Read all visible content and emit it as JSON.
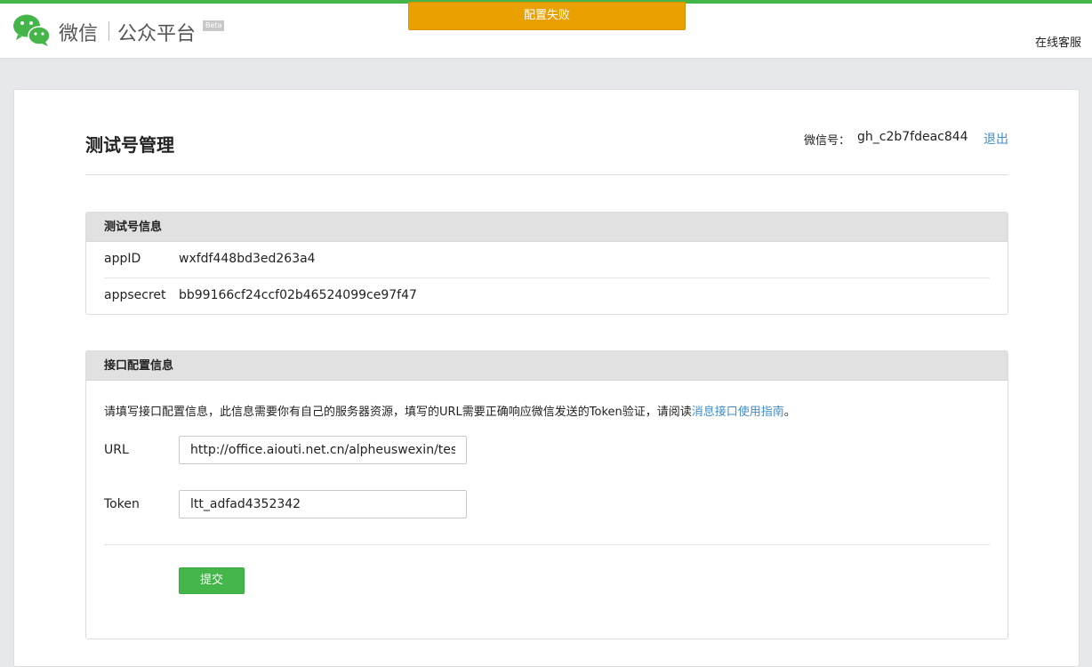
{
  "header": {
    "brand_wechat": "微信",
    "brand_platform": "公众平台",
    "beta": "Beta",
    "service_link": "在线客服",
    "accent_color": "#44b549"
  },
  "toast": {
    "message": "配置失败",
    "color": "#e9a000"
  },
  "page": {
    "title": "测试号管理",
    "account_label": "微信号：",
    "account_value": "gh_c2b7fdeac844",
    "logout": "退出"
  },
  "test_account": {
    "heading": "测试号信息",
    "rows": [
      {
        "key": "appID",
        "value": "wxfdf448bd3ed263a4"
      },
      {
        "key": "appsecret",
        "value": "bb99166cf24ccf02b46524099ce97f47"
      }
    ]
  },
  "interface_config": {
    "heading": "接口配置信息",
    "description": "请填写接口配置信息，此信息需要你有自己的服务器资源，填写的URL需要正确响应微信发送的Token验证，请阅读",
    "guide_link": "消息接口使用指南",
    "description_end": "。",
    "url_label": "URL",
    "url_value": "http://office.aiouti.net.cn/alpheuswexin/test",
    "token_label": "Token",
    "token_value": "ltt_adfad4352342",
    "submit_label": "提交"
  }
}
